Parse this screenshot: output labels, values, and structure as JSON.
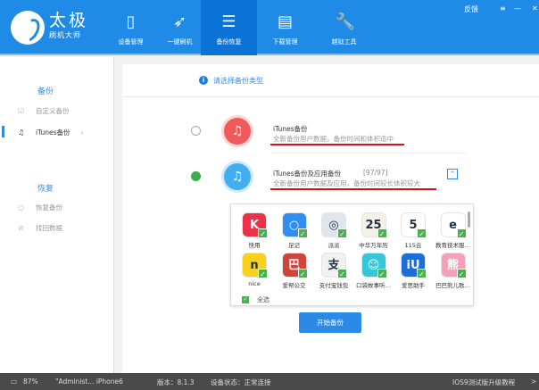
{
  "app": {
    "brand_main": "太极",
    "brand_sub": "刷机大师"
  },
  "nav": [
    {
      "label": "设备管理",
      "icon": "phone-icon"
    },
    {
      "label": "一键刷机",
      "icon": "rocket-icon"
    },
    {
      "label": "备份恢复",
      "icon": "database-icon"
    },
    {
      "label": "下载管理",
      "icon": "bag-icon"
    },
    {
      "label": "越狱工具",
      "icon": "wrench-icon"
    }
  ],
  "window": {
    "feedback": "反馈",
    "menu": "≡",
    "minimize": "—",
    "close": "✕"
  },
  "sidebar": {
    "backup_title": "备份",
    "custom_backup": "自定义备份",
    "itunes_backup": "iTunes备份",
    "restore_title": "恢复",
    "restore_backup": "恢复备份",
    "recover_data": "找回数据"
  },
  "main": {
    "prompt": "请选择备份类型",
    "option1": {
      "title": "iTunes备份",
      "desc": "全新备份用户数据，备份时间和体积适中"
    },
    "option2": {
      "title": "iTunes备份及应用备份",
      "count": "[97/97]",
      "desc": "全新备份用户数据及应用，备份时间较长体积较大"
    },
    "apps": [
      {
        "name": "快用",
        "color": "#e8334a",
        "glyph": "K"
      },
      {
        "name": "足记",
        "color": "#2f8ef0",
        "glyph": "○"
      },
      {
        "name": "派派",
        "color": "#dfe6ee",
        "glyph": "◎"
      },
      {
        "name": "中华万年历",
        "color": "#f4f1e8",
        "glyph": "25"
      },
      {
        "name": "115云",
        "color": "#ffffff",
        "glyph": "5"
      },
      {
        "name": "教育技术服…",
        "color": "#ffffff",
        "glyph": "e"
      },
      {
        "name": "nice",
        "color": "#f7d21a",
        "glyph": "n"
      },
      {
        "name": "爱帮公交",
        "color": "#d0453a",
        "glyph": "巴"
      },
      {
        "name": "支付宝钱包",
        "color": "#f1f1f1",
        "glyph": "支"
      },
      {
        "name": "口袋故事听…",
        "color": "#35c7d8",
        "glyph": "☺"
      },
      {
        "name": "爱思助手",
        "color": "#1c6fd8",
        "glyph": "iU"
      },
      {
        "name": "巴巴熊儿歌…",
        "color": "#f3a0b8",
        "glyph": "熊"
      }
    ],
    "select_all": "全选",
    "start_button": "开始备份"
  },
  "status": {
    "battery": "87%",
    "device_name": "\"Administ... iPhone6",
    "version": "版本：8.1.3",
    "device_status": "设备状态：正常连接",
    "tutorial": "IOS9测试版升级教程",
    "more": ">"
  },
  "colors": {
    "primary": "#1f8be6",
    "active_tab": "#0b73d6",
    "check": "#4caf50",
    "underline": "#d6121e"
  }
}
